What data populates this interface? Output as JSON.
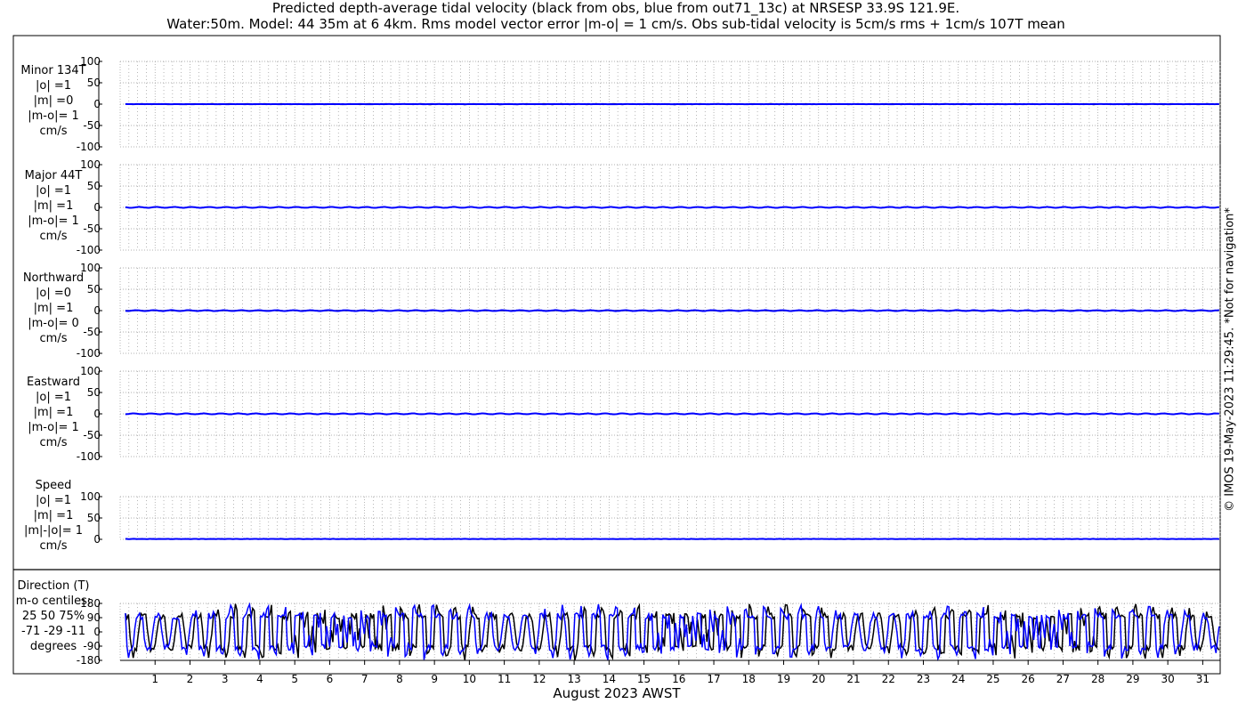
{
  "title_line1": "Predicted depth-average tidal velocity (black from obs, blue from out71_13c) at NRSESP 33.9S 121.9E.",
  "title_line2": "Water:50m. Model: 44 35m at 6 4km. Rms model vector error |m-o| = 1 cm/s. Obs sub-tidal velocity is 5cm/s rms + 1cm/s 107T mean",
  "copyright": "© IMOS 19-May-2023 11:29:45.  *Not for navigation*",
  "colors": {
    "obs": "#000000",
    "model": "#0000ff",
    "grid": "#999999"
  },
  "chart_data": {
    "type": "line",
    "xlabel": "August 2023 AWST",
    "xlim": [
      0,
      31.5
    ],
    "x_ticks": [
      "1",
      "2",
      "3",
      "4",
      "5",
      "6",
      "7",
      "8",
      "9",
      "10",
      "11",
      "12",
      "13",
      "14",
      "15",
      "16",
      "17",
      "18",
      "19",
      "20",
      "21",
      "22",
      "23",
      "24",
      "25",
      "26",
      "27",
      "28",
      "29",
      "30",
      "31"
    ],
    "grid": true,
    "series_names": [
      "obs",
      "model"
    ],
    "panels": [
      {
        "id": "minor",
        "label": [
          "Minor 134T",
          "|o| =1",
          "|m| =0",
          "|m-o|= 1",
          "cm/s"
        ],
        "ylim": [
          -100,
          100
        ],
        "yticks": [
          "100",
          "50",
          "0",
          "-50",
          "-100"
        ],
        "obs_amplitude": 1,
        "model_amplitude": 0
      },
      {
        "id": "major",
        "label": [
          "Major 44T",
          "|o| =1",
          "|m| =1",
          "|m-o|= 1",
          "cm/s"
        ],
        "ylim": [
          -100,
          100
        ],
        "yticks": [
          "100",
          "50",
          "0",
          "-50",
          "-100"
        ],
        "obs_amplitude": 1,
        "model_amplitude": 1
      },
      {
        "id": "north",
        "label": [
          "Northward",
          "|o| =0",
          "|m| =1",
          "|m-o|= 0",
          "cm/s"
        ],
        "ylim": [
          -100,
          100
        ],
        "yticks": [
          "100",
          "50",
          "0",
          "-50",
          "-100"
        ],
        "obs_amplitude": 0,
        "model_amplitude": 1
      },
      {
        "id": "east",
        "label": [
          "Eastward",
          "|o| =1",
          "|m| =1",
          "|m-o|= 1",
          "cm/s"
        ],
        "ylim": [
          -100,
          100
        ],
        "yticks": [
          "100",
          "50",
          "0",
          "-50",
          "-100"
        ],
        "obs_amplitude": 1,
        "model_amplitude": 1
      },
      {
        "id": "speed",
        "label": [
          "Speed",
          "|o| =1",
          "|m| =1",
          "|m|-|o|= 1",
          "cm/s"
        ],
        "ylim": [
          0,
          100
        ],
        "yticks": [
          "100",
          "50",
          "0"
        ],
        "obs_amplitude": 1,
        "model_amplitude": 1
      },
      {
        "id": "direction",
        "label": [
          "Direction (T)",
          "m-o centiles:",
          "25  50  75%",
          "-71 -29 -11",
          "degrees"
        ],
        "ylim": [
          -180,
          180
        ],
        "yticks": [
          "180",
          "90",
          "0",
          "-90",
          "-180"
        ],
        "obs_range": [
          -180,
          180
        ],
        "model_range": [
          -180,
          180
        ]
      }
    ]
  }
}
